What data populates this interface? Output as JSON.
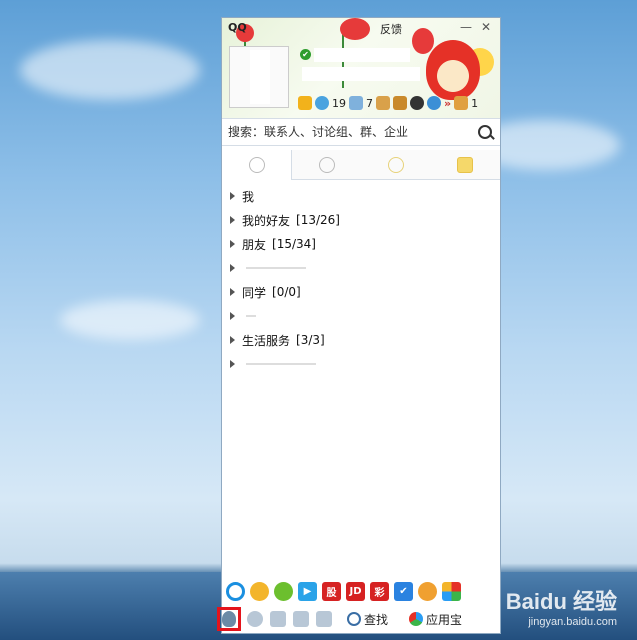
{
  "window": {
    "title": "QQ",
    "feedback_label": "反馈"
  },
  "profile": {
    "icon_counts": {
      "messages": "19",
      "mail": "7",
      "box": "1"
    }
  },
  "search": {
    "placeholder": "搜索：联系人、讨论组、群、企业"
  },
  "tabs": [
    {
      "name": "contacts",
      "icon": "contact-icon"
    },
    {
      "name": "groups",
      "icon": "group-icon"
    },
    {
      "name": "space",
      "icon": "space-icon"
    },
    {
      "name": "recent",
      "icon": "chat-icon"
    }
  ],
  "groups": [
    {
      "name": "我",
      "count": ""
    },
    {
      "name": "我的好友",
      "count": "[13/26]"
    },
    {
      "name": "朋友",
      "count": "[15/34]"
    },
    {
      "name": "",
      "count": ""
    },
    {
      "name": "同学",
      "count": "[0/0]"
    },
    {
      "name": "",
      "count": ""
    },
    {
      "name": "生活服务",
      "count": "[3/3]"
    },
    {
      "name": "",
      "count": ""
    }
  ],
  "bottom": {
    "find_label": "查找",
    "appstore_label": "应用宝"
  },
  "apps": {
    "stock": "股",
    "jd": "JD",
    "lottery": "彩"
  },
  "watermark": {
    "brand": "Baidu 经验",
    "url": "jingyan.baidu.com"
  },
  "colors": {
    "highlight": "#e4141c",
    "qq_blue": "#3a6ea5"
  }
}
